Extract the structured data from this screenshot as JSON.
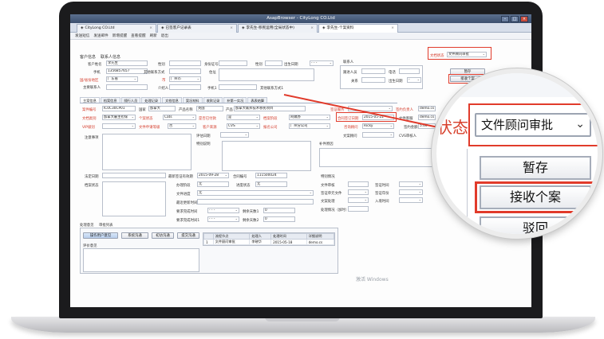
{
  "window": {
    "title": "AsapBrowser - CityLong CO.Ltd"
  },
  "tabs": [
    {
      "label": "CityLong CO.Ltd",
      "close": "×"
    },
    {
      "label": "已签客户记录表",
      "close": "×"
    },
    {
      "label": "李先生-移民运用(全局状态中)",
      "close": "×"
    },
    {
      "label": "李先生-个案资料",
      "close": "×"
    }
  ],
  "menu": [
    "发送短信",
    "发送邮件",
    "新增提醒",
    "查看提醒",
    "刷新",
    "退出"
  ],
  "customer": {
    "section_title": "客户信息",
    "contact_title": "联系人信息",
    "name_label": "客户姓名",
    "name_value": "李先生",
    "mobile_label": "手机",
    "mobile_value": "1356857657",
    "status_label": "国/省份地区",
    "status_value": "广东省",
    "main_contact_label": "主要联系人",
    "mobile2_label": "手机1",
    "birth_label": "出生日期",
    "gender_label": "性别",
    "other_label": "其他联系方式",
    "address_label": "住址",
    "city_value": "广州市",
    "id_label": "身份证号码",
    "other2_label": "其他联系方式1",
    "introducer_label": "介绍人",
    "follow_label": "跟进人员",
    "relation_label": "关系",
    "phone_label": "电话",
    "birth2_label": "出生日期"
  },
  "right_panel": {
    "doc_status_label": "文档状态",
    "doc_status_value": "文件顾问审批",
    "save_btn": "暂存",
    "receive_btn": "接收个案",
    "reject_btn": "驳回"
  },
  "subtabs": [
    "主案信息",
    "档案信息",
    "随行人员",
    "处理记录",
    "文档信息",
    "案况材料",
    "收款记录",
    "补第一实况",
    "表表结算"
  ],
  "case": {
    "case_no_label": "案件编号",
    "case_no_value": "IC0C30CP01",
    "country_label": "国家",
    "country_value": "加拿大",
    "product_label": "产品名称",
    "product_value": "英国",
    "program_label": "产品",
    "program_value": "加拿大联邦技术移民项目",
    "service_label": "签证服务",
    "sign_label": "签约负责人",
    "sign_value": "demo.cs",
    "case_type_label": "文档类别",
    "case_type_value": "加拿大雇主担保",
    "fee_label": "个案状态",
    "fee_value": "Cats",
    "charge_label": "是否已付款",
    "charge_value": "是",
    "stage_label": "档案阶段",
    "stage_value": "阿姨办",
    "submit_label": "合同签订日期",
    "submit_value": "2015-05-22",
    "doc_label": "文件客服",
    "doc_value": "demo.cs",
    "grade_label": "VIP级别",
    "appeal_label": "文件申请等级",
    "appeal_value": "否",
    "source_label": "客户来源",
    "source_value": "CVS",
    "company_label": "报名公司",
    "company_value": "广州分公司",
    "consult_label": "咨询顾问",
    "consult_value": "Ricky",
    "amount_label": "签约金额",
    "amount_value": "5.00",
    "copywriter_label": "文案顾问",
    "review_label": "CVS审核人",
    "note_label": "注意事项",
    "evaluation_label": "评估日期",
    "eval_detail_label": "特别说明",
    "reason_label": "补件原因",
    "review2_label": "补件情况",
    "file_no_label": "法定日期",
    "expire_label": "最新签证有效期",
    "expire_value": "2015-09-28",
    "contract_label": "合同编号",
    "contract_value": "111500024",
    "other_case_label": "其他事项",
    "handle_label": "办理阶段",
    "handle_value": "无",
    "status2_label": "进度状态",
    "status2_value": "无",
    "progress_label": "文件进度",
    "progress_value": "无",
    "special_label": "特别情况",
    "doc_handling_label": "文件审核",
    "visa_label": "签证单元文件",
    "place_label": "文案处理",
    "history_label": "档案状态",
    "history2_label": "签证时间",
    "date1_label": "最近更新时间",
    "date2_label": "签证年份",
    "date3_label": "入境时间",
    "date4_label": "报到时间",
    "date5_label": "要求完成时间",
    "date6_label": "要求完成时间1",
    "days1_label": "剩余天数1",
    "days2_label": "剩余天数2",
    "days3_label": "剩余天数3",
    "days1_value": "0",
    "days2_value": "0",
    "note2_label": "处理情况（加时）",
    "review_box_label": "处理意见",
    "case_review_label": "个案审查",
    "pay_label": "备注栏目"
  },
  "bottom": {
    "tabs": [
      "处理意见",
      "审批列表"
    ],
    "buttons": [
      "操作用户意见",
      "系统沟通",
      "初访沟通",
      "提交沟通"
    ],
    "review_label": "评价意见",
    "grid_headers": [
      "流程节点",
      "处理人",
      "处理时间",
      "详细说明"
    ],
    "grid_rows": [
      {
        "idx": "1",
        "node": "文件顾问审批",
        "user": "李晓华",
        "time": "2015-05-18",
        "desc": "demo.cs"
      }
    ]
  },
  "watermark": "激活 Windows"
}
